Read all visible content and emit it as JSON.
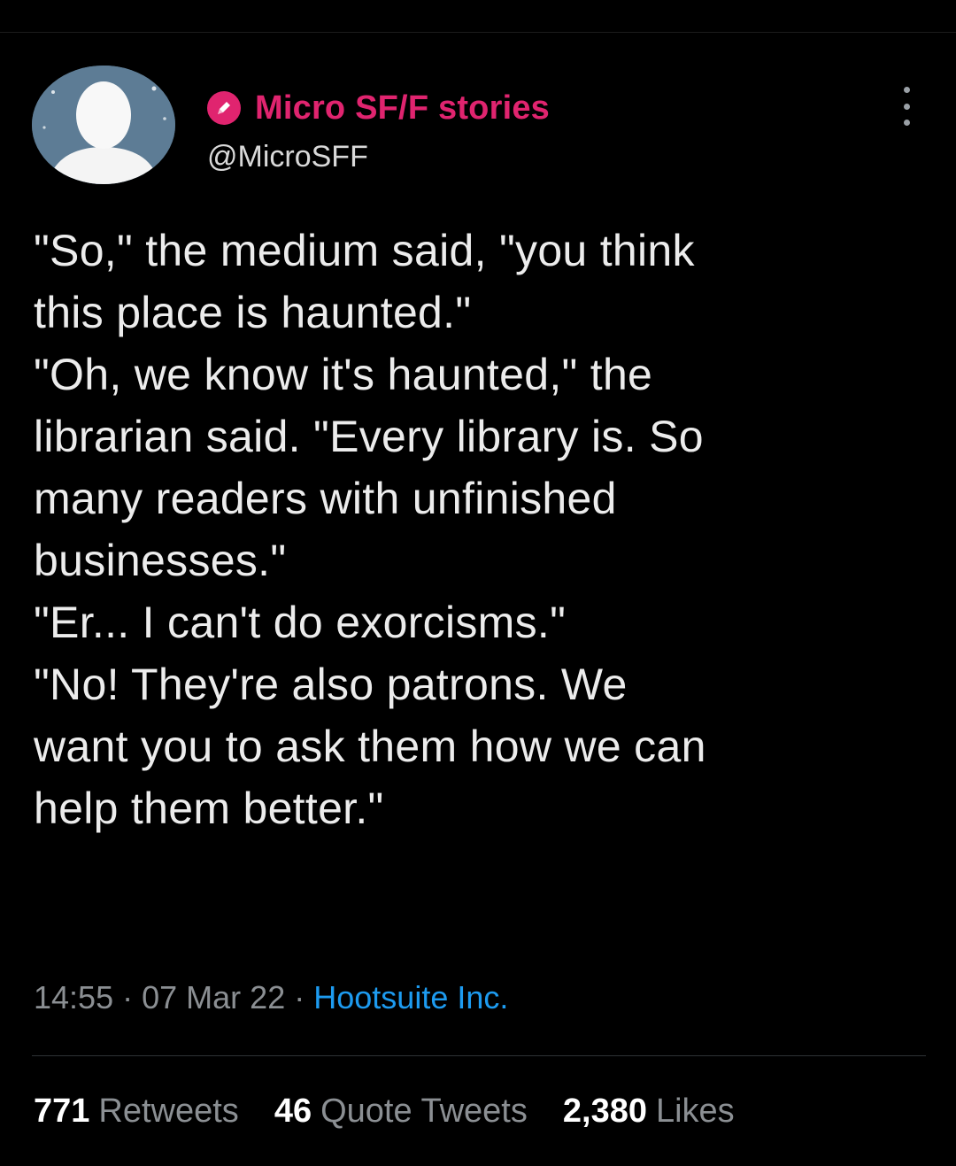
{
  "account": {
    "display_name": "Micro SF/F stories",
    "handle": "@MicroSFF",
    "avatar_icon": "egg-avatar-icon",
    "badge_icon": "pen-icon",
    "accent_color": "#e0246f"
  },
  "tweet": {
    "text": "\"So,\" the medium said, \"you think\nthis place is haunted.\"\n\"Oh, we know it's haunted,\" the\nlibrarian said. \"Every library is. So\nmany readers with unfinished\nbusinesses.\"\n\"Er... I can't do exorcisms.\"\n\"No! They're also patrons. We\nwant you to ask them how we can\nhelp them better.\"",
    "time": "14:55",
    "date": "07 Mar 22",
    "separator": "·",
    "source": "Hootsuite Inc.",
    "source_color": "#1d9bf0"
  },
  "stats": {
    "retweets": {
      "count": "771",
      "label": "Retweets"
    },
    "quote_tweets": {
      "count": "46",
      "label": "Quote Tweets"
    },
    "likes": {
      "count": "2,380",
      "label": "Likes"
    }
  }
}
